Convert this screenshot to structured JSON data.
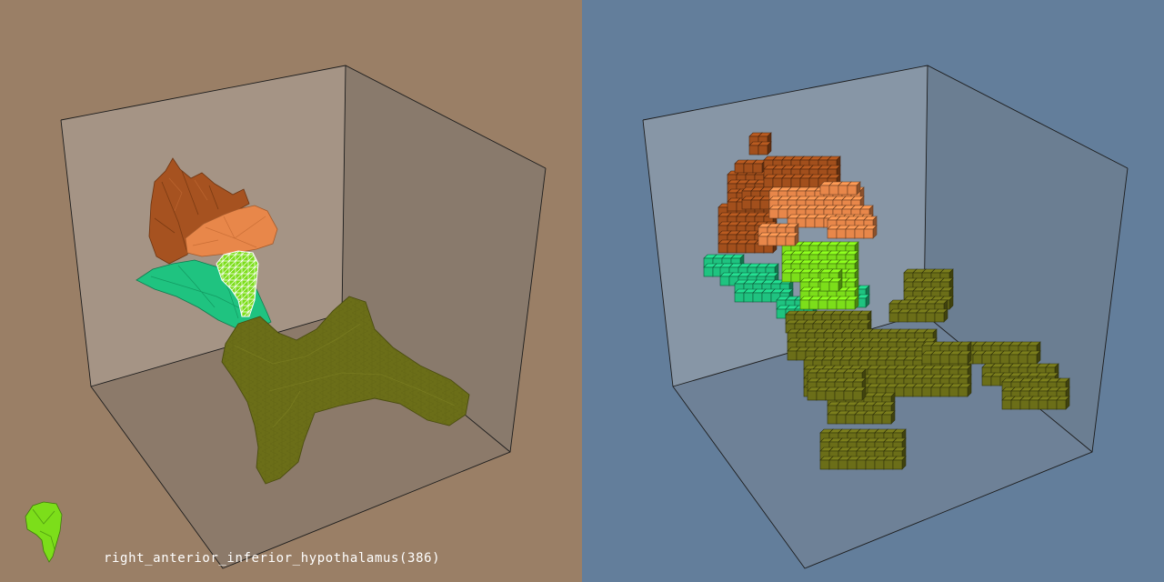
{
  "viewer": {
    "surface_panel": {
      "background": "#9a7f66"
    },
    "voxel_panel": {
      "background": "#637e9b"
    }
  },
  "structures": [
    {
      "id": "right_anterior_inferior_hypothalamus",
      "color": "#7cde1a",
      "selected": true
    },
    {
      "id": "orange-region",
      "color": "#e8874a"
    },
    {
      "id": "brown-region",
      "color": "#a24f1c"
    },
    {
      "id": "teal-region",
      "color": "#1fc380"
    },
    {
      "id": "olive-region",
      "color": "#6b6e18"
    }
  ],
  "selection": {
    "icon": "hypothalamus-thumbnail-icon",
    "label": "right_anterior_inferior_hypothalamus(386)"
  }
}
